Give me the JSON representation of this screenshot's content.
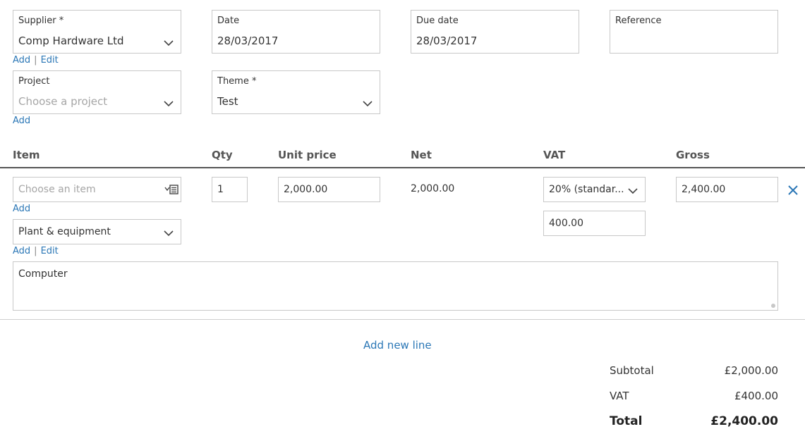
{
  "header": {
    "supplier": {
      "label": "Supplier *",
      "value": "Comp Hardware Ltd",
      "add": "Add",
      "edit": "Edit",
      "sep": "|"
    },
    "date": {
      "label": "Date",
      "value": "28/03/2017"
    },
    "due_date": {
      "label": "Due date",
      "value": "28/03/2017"
    },
    "reference": {
      "label": "Reference",
      "value": ""
    },
    "project": {
      "label": "Project",
      "placeholder": "Choose a project",
      "add": "Add"
    },
    "theme": {
      "label": "Theme *",
      "value": "Test"
    }
  },
  "columns": [
    "Item",
    "Qty",
    "Unit price",
    "Net",
    "VAT",
    "Gross"
  ],
  "line": {
    "item_placeholder": "Choose an item",
    "item_add": "Add",
    "qty": "1",
    "unit_price": "2,000.00",
    "net": "2,000.00",
    "vat_rate": "20% (standar...",
    "vat_amount": "400.00",
    "gross": "2,400.00",
    "category": "Plant & equipment",
    "category_add": "Add",
    "category_edit": "Edit",
    "category_sep": "|",
    "description": "Computer"
  },
  "add_new_line": "Add new line",
  "totals": {
    "subtotal_label": "Subtotal",
    "subtotal": "£2,000.00",
    "vat_label": "VAT",
    "vat": "£400.00",
    "total_label": "Total",
    "total": "£2,400.00"
  },
  "colors": {
    "link": "#2b77b6",
    "border": "#c8c8c8",
    "close": "#2b77b6"
  },
  "icons": [
    "chevron-down-icon",
    "item-list-icon",
    "close-icon",
    "resize-grip-icon"
  ]
}
